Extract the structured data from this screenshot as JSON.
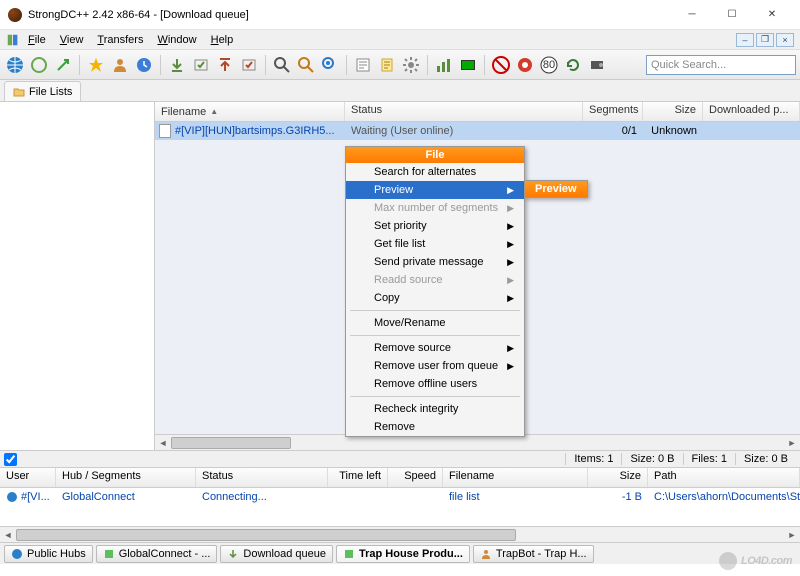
{
  "window": {
    "title": "StrongDC++ 2.42 x86-64 - [Download queue]"
  },
  "menu": {
    "file": "File",
    "view": "View",
    "transfers": "Transfers",
    "window": "Window",
    "help": "Help"
  },
  "search": {
    "placeholder": "Quick Search..."
  },
  "top_tab": {
    "label": "File Lists"
  },
  "columns": {
    "filename": "Filename",
    "status": "Status",
    "segments": "Segments",
    "size": "Size",
    "downloaded": "Downloaded p..."
  },
  "queue_row": {
    "filename": "#[VIP][HUN]bartsimps.G3IRH5...",
    "status": "Waiting (User online)",
    "segments": "0/1",
    "size": "Unknown",
    "downloaded": ""
  },
  "context_menu": {
    "title": "File",
    "search_alternates": "Search for alternates",
    "preview": "Preview",
    "max_segments": "Max number of segments",
    "set_priority": "Set priority",
    "get_file_list": "Get file list",
    "send_pm": "Send private message",
    "readd_source": "Readd source",
    "copy": "Copy",
    "move_rename": "Move/Rename",
    "remove_source": "Remove source",
    "remove_user": "Remove user from queue",
    "remove_offline": "Remove offline users",
    "recheck": "Recheck integrity",
    "remove": "Remove"
  },
  "submenu": {
    "title": "Preview"
  },
  "status_strip": {
    "items": "Items: 1",
    "size": "Size: 0 B",
    "files": "Files: 1",
    "size2": "Size: 0 B"
  },
  "lower_columns": {
    "user": "User",
    "hub": "Hub / Segments",
    "status": "Status",
    "time": "Time left",
    "speed": "Speed",
    "filename": "Filename",
    "size": "Size",
    "path": "Path"
  },
  "lower_row": {
    "user": "#[VI...",
    "hub": "GlobalConnect",
    "status": "Connecting...",
    "time": "",
    "speed": "",
    "filename": "file list",
    "size": "-1 B",
    "path": "C:\\Users\\ahorn\\Documents\\Stro..."
  },
  "bottom_tabs": {
    "public_hubs": "Public Hubs",
    "globalconnect": "GlobalConnect - ...",
    "download_queue": "Download queue",
    "trap_house": "Trap House Produ...",
    "trapbot": "TrapBot - Trap H..."
  },
  "watermark": "LO4D.com",
  "icons": {
    "globe": "#2a80c8",
    "star": "#f4b400",
    "refresh": "#6aa84f",
    "toolbar_colors": [
      "#2a80c8",
      "#6aa84f",
      "#f4b400",
      "#d06800",
      "#3b7dd8",
      "#9aa",
      "#888",
      "#888",
      "#888",
      "#888",
      "#888",
      "#5b8d3e",
      "#a05a2c",
      "#888",
      "#c00",
      "#333",
      "#333",
      "#b07d3a",
      "#777",
      "#777"
    ]
  }
}
